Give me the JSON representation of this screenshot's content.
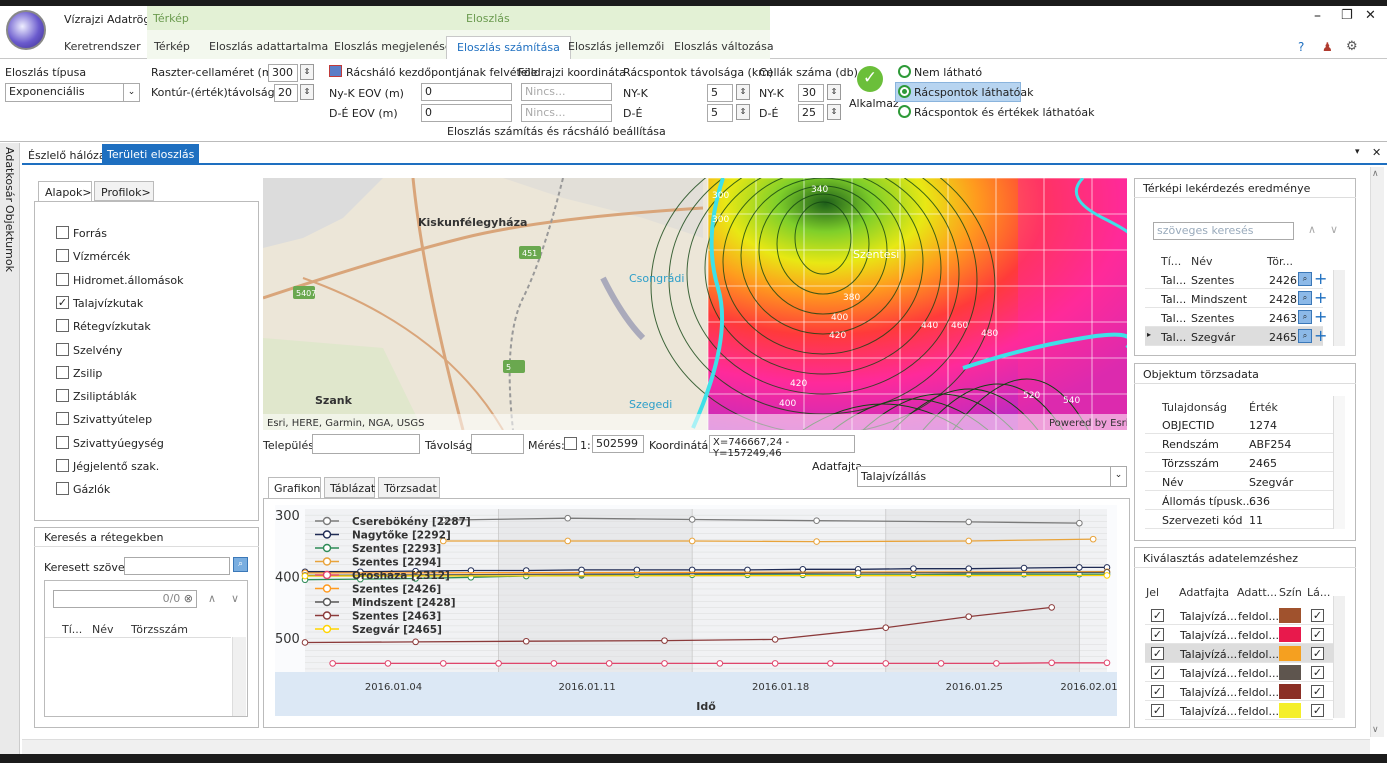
{
  "app": {
    "title": "Vízrajzi Adatrögz...",
    "colors": {
      "accent": "#1e6fc0",
      "green": "#2e9a38",
      "ctx": "#e3f1d5"
    }
  },
  "ribbon_tabs": {
    "ctx_map": "Térkép",
    "ctx_dist": "Eloszlás",
    "items": [
      "Keretrendszer",
      "Térkép",
      "Eloszlás adattartalma",
      "Eloszlás megjelenése",
      "Eloszlás számítása",
      "Eloszlás jellemzői",
      "Eloszlás változása"
    ],
    "active": "Eloszlás számítása"
  },
  "window_controls": {
    "minimize": "–",
    "restore": "❐",
    "close": "✕",
    "help": "?",
    "user": "♟",
    "settings": "⚙"
  },
  "ribbon": {
    "type_label": "Eloszlás típusa",
    "type_value": "Exponenciális",
    "cell_label": "Raszter-cellaméret (m)",
    "cell_value": "300",
    "contour_label": "Kontúr-(érték)távolság",
    "contour_value": "20",
    "grid_start_label": "Rácsháló kezdőpontjának felvétele",
    "geo_label": "Földrajzi koordináta",
    "nyk_eov_label": "Ny-K EOV (m)",
    "nyk_eov_value": "0",
    "de_eov_label": "D-É EOV (m)",
    "de_eov_value": "0",
    "geo1_placeholder": "Nincs...",
    "geo2_placeholder": "Nincs...",
    "spacing_label": "Rácspontok távolsága (km)",
    "nyk": "NY-K",
    "de": "D-É",
    "spacing_nyk": "5",
    "spacing_de": "5",
    "cells_label": "Cellák száma (db)",
    "cells_nyk_label": "NY-K",
    "cells_de_label": "D-É",
    "cells_nyk": "30",
    "cells_de": "25",
    "apply_label": "Alkalmaz",
    "group_caption": "Eloszlás számítás és rácsháló beállítása",
    "radios": [
      "Nem látható",
      "Rácspontok láthatóak",
      "Rácspontok és értékek láthatóak"
    ],
    "radio_selected": 1
  },
  "side_tabs": [
    "Adatkosár",
    "Objektumok"
  ],
  "doc_tabs": {
    "items": [
      "Észlelő hálózat",
      "Területi eloszlás"
    ],
    "active": 1
  },
  "left_panel": {
    "tabs": [
      "Alapok>",
      "Profilok>"
    ],
    "layers": [
      {
        "label": "Forrás",
        "checked": false
      },
      {
        "label": "Vízmércék",
        "checked": false
      },
      {
        "label": "Hidromet.állomások",
        "checked": false
      },
      {
        "label": "Talajvízkutak",
        "checked": true
      },
      {
        "label": "Rétegvízkutak",
        "checked": false
      },
      {
        "label": "Szelvény",
        "checked": false
      },
      {
        "label": "Zsilip",
        "checked": false
      },
      {
        "label": "Zsiliptáblák",
        "checked": false
      },
      {
        "label": "Szivattyútelep",
        "checked": false
      },
      {
        "label": "Szivattyúegység",
        "checked": false
      },
      {
        "label": "Jégjelentő szak.",
        "checked": false
      },
      {
        "label": "Gázlók",
        "checked": false
      }
    ],
    "search_title": "Keresés a rétegekben",
    "search_label": "Keresett szöveg:",
    "search_count": "0/0",
    "columns": [
      "Tí...",
      "Név",
      "Törzsszám"
    ]
  },
  "map": {
    "places": [
      "Kiskunfélegyháza",
      "Csongrádi",
      "Szentesi",
      "Szank",
      "Szegedi"
    ],
    "contours": [
      "340",
      "380",
      "400",
      "420",
      "440",
      "460",
      "480",
      "420",
      "400",
      "300",
      "300",
      "520",
      "540"
    ],
    "attribution": "Esri, HERE, Garmin, NGA, USGS",
    "powered": "Powered by Esri",
    "road_numbers": [
      "451",
      "5",
      "5407"
    ]
  },
  "map_bar": {
    "telepules_label": "Település:",
    "tavolsag_label": "Távolság:",
    "meres_label": "Mérés:",
    "scale_prefix": "1:",
    "scale_value": "502599",
    "coord_label": "Koordináták",
    "coord_value": "X=746667,24 - Y=157249,46"
  },
  "data_type": {
    "label": "Adatfajta",
    "value": "Talajvízállás"
  },
  "chart_tabs": {
    "items": [
      "Grafikon",
      "Táblázat",
      "Törzsadat"
    ],
    "active": 0
  },
  "chart_data": {
    "type": "line",
    "xlabel": "Idő",
    "x_ticks": [
      "2016.01.04",
      "2016.01.11",
      "2016.01.18",
      "2016.01.25",
      "2016.02.01"
    ],
    "y_ticks": [
      "300",
      "400",
      "500"
    ],
    "y_reversed": true,
    "ylim": [
      555,
      290
    ],
    "xlim": [
      0,
      29
    ],
    "series": [
      {
        "name": "Cserebökény [2287]",
        "color": "#7a7a7a",
        "x": [
          5,
          9.5,
          14,
          18.5,
          24,
          28
        ],
        "values": [
          308,
          305,
          307,
          309,
          311,
          313
        ]
      },
      {
        "name": "Nagytőke [2292]",
        "color": "#1f2b55",
        "x": [
          0,
          2,
          4,
          6,
          8,
          10,
          12,
          14,
          16,
          18,
          20,
          22,
          24,
          26,
          28,
          29
        ],
        "values": [
          392,
          392,
          391,
          390,
          390,
          389,
          389,
          389,
          389,
          388,
          388,
          387,
          387,
          386,
          385,
          385
        ]
      },
      {
        "name": "Szentes [2293]",
        "color": "#2e8b57",
        "x": [
          0,
          2,
          4,
          6,
          8,
          10,
          12,
          14,
          16,
          18,
          20,
          22,
          24,
          26,
          28,
          29
        ],
        "values": [
          405,
          404,
          403,
          401,
          399,
          398,
          397,
          397,
          397,
          397,
          397,
          397,
          396,
          396,
          396,
          396
        ]
      },
      {
        "name": "Szentes [2294]",
        "color": "#e8a33a",
        "x": [
          5,
          9.5,
          14,
          18.5,
          24,
          28.5
        ],
        "values": [
          342,
          342,
          342,
          343,
          342,
          339
        ]
      },
      {
        "name": "Orosháza [2312]",
        "color": "#e0456b",
        "x": [
          1,
          3,
          5,
          7,
          9,
          11,
          13,
          15,
          17,
          19,
          21,
          23,
          25,
          27,
          29
        ],
        "values": [
          541,
          541,
          541,
          541,
          541,
          541,
          541,
          541,
          541,
          541,
          541,
          541,
          541,
          540,
          540
        ]
      },
      {
        "name": "Szentes [2426]",
        "color": "#ff9a1f",
        "x": [
          0,
          29
        ],
        "values": [
          394,
          392
        ]
      },
      {
        "name": "Mindszent [2428]",
        "color": "#5a5a5a",
        "x": [
          0,
          10,
          20,
          29
        ],
        "values": [
          398,
          396,
          394,
          393
        ]
      },
      {
        "name": "Szentes [2463]",
        "color": "#8b3a3a",
        "x": [
          0,
          4,
          8,
          13,
          17,
          21,
          24,
          27
        ],
        "values": [
          507,
          506,
          505,
          504,
          502,
          483,
          465,
          450
        ]
      },
      {
        "name": "Szegvár [2465]",
        "color": "#ffd400",
        "x": [
          0,
          29
        ],
        "values": [
          399,
          398
        ]
      }
    ]
  },
  "right_query": {
    "title": "Térképi lekérdezés eredménye",
    "search_placeholder": "szöveges keresés",
    "columns": [
      "Tí...",
      "Név",
      "Tör..."
    ],
    "rows": [
      {
        "type": "Tal...",
        "name": "Szentes",
        "id": "2426"
      },
      {
        "type": "Tal...",
        "name": "Mindszent",
        "id": "2428"
      },
      {
        "type": "Tal...",
        "name": "Szentes",
        "id": "2463"
      },
      {
        "type": "Tal...",
        "name": "Szegvár",
        "id": "2465"
      }
    ]
  },
  "master_data": {
    "title": "Objektum törzsadata",
    "columns": [
      "Tulajdonság",
      "Érték"
    ],
    "rows": [
      {
        "k": "OBJECTID",
        "v": "1274"
      },
      {
        "k": "Rendszám",
        "v": "ABF254"
      },
      {
        "k": "Törzsszám",
        "v": "2465"
      },
      {
        "k": "Név",
        "v": "Szegvár"
      },
      {
        "k": "Állomás típusk...",
        "v": "636"
      },
      {
        "k": "Szervezeti kód",
        "v": "11"
      }
    ]
  },
  "selection": {
    "title": "Kiválasztás adatelemzéshez",
    "columns": [
      "Jel",
      "Adatfajta",
      "Adatt...",
      "Szín",
      "Lá..."
    ],
    "rows": [
      {
        "kind": "Talajvízá...",
        "src": "feldol...",
        "color": "#a0522d"
      },
      {
        "kind": "Talajvízá...",
        "src": "feldol...",
        "color": "#e8194c"
      },
      {
        "kind": "Talajvízá...",
        "src": "feldol...",
        "color": "#f5a020"
      },
      {
        "kind": "Talajvízá...",
        "src": "feldol...",
        "color": "#5e554e"
      },
      {
        "kind": "Talajvízá...",
        "src": "feldol...",
        "color": "#8b2f25"
      },
      {
        "kind": "Talajvízá...",
        "src": "feldol...",
        "color": "#f5ef2a"
      }
    ]
  }
}
